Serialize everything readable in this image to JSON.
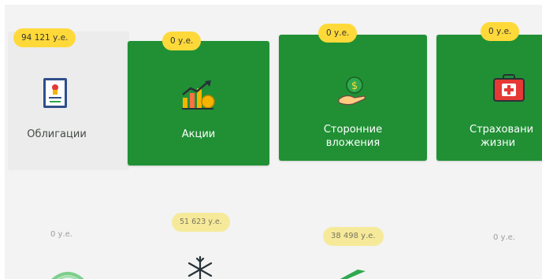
{
  "cards": [
    {
      "label": "Облигации",
      "amount": "94 121 у.е.",
      "icon": "bond-certificate-icon"
    },
    {
      "label": "Акции",
      "amount": "0 у.е.",
      "icon": "stock-chart-icon"
    },
    {
      "label_line1": "Сторонние",
      "label_line2": "вложения",
      "amount": "0 у.е.",
      "icon": "money-hand-icon"
    },
    {
      "label_line1": "Страховани",
      "label_line2": "жизни",
      "amount": "0 у.е.",
      "icon": "first-aid-kit-icon"
    }
  ],
  "row2": [
    {
      "amount": "0 у.е.",
      "icon": "sber-logo-icon"
    },
    {
      "amount": "51 623 у.е.",
      "icon": "snowflake-icon"
    },
    {
      "amount": "38 498 у.е.",
      "icon": "green-check-icon"
    },
    {
      "amount": "0 у.е."
    }
  ],
  "colors": {
    "card_green": "#219035",
    "badge_yellow": "#ffd93a",
    "background": "#f2f3f2"
  }
}
